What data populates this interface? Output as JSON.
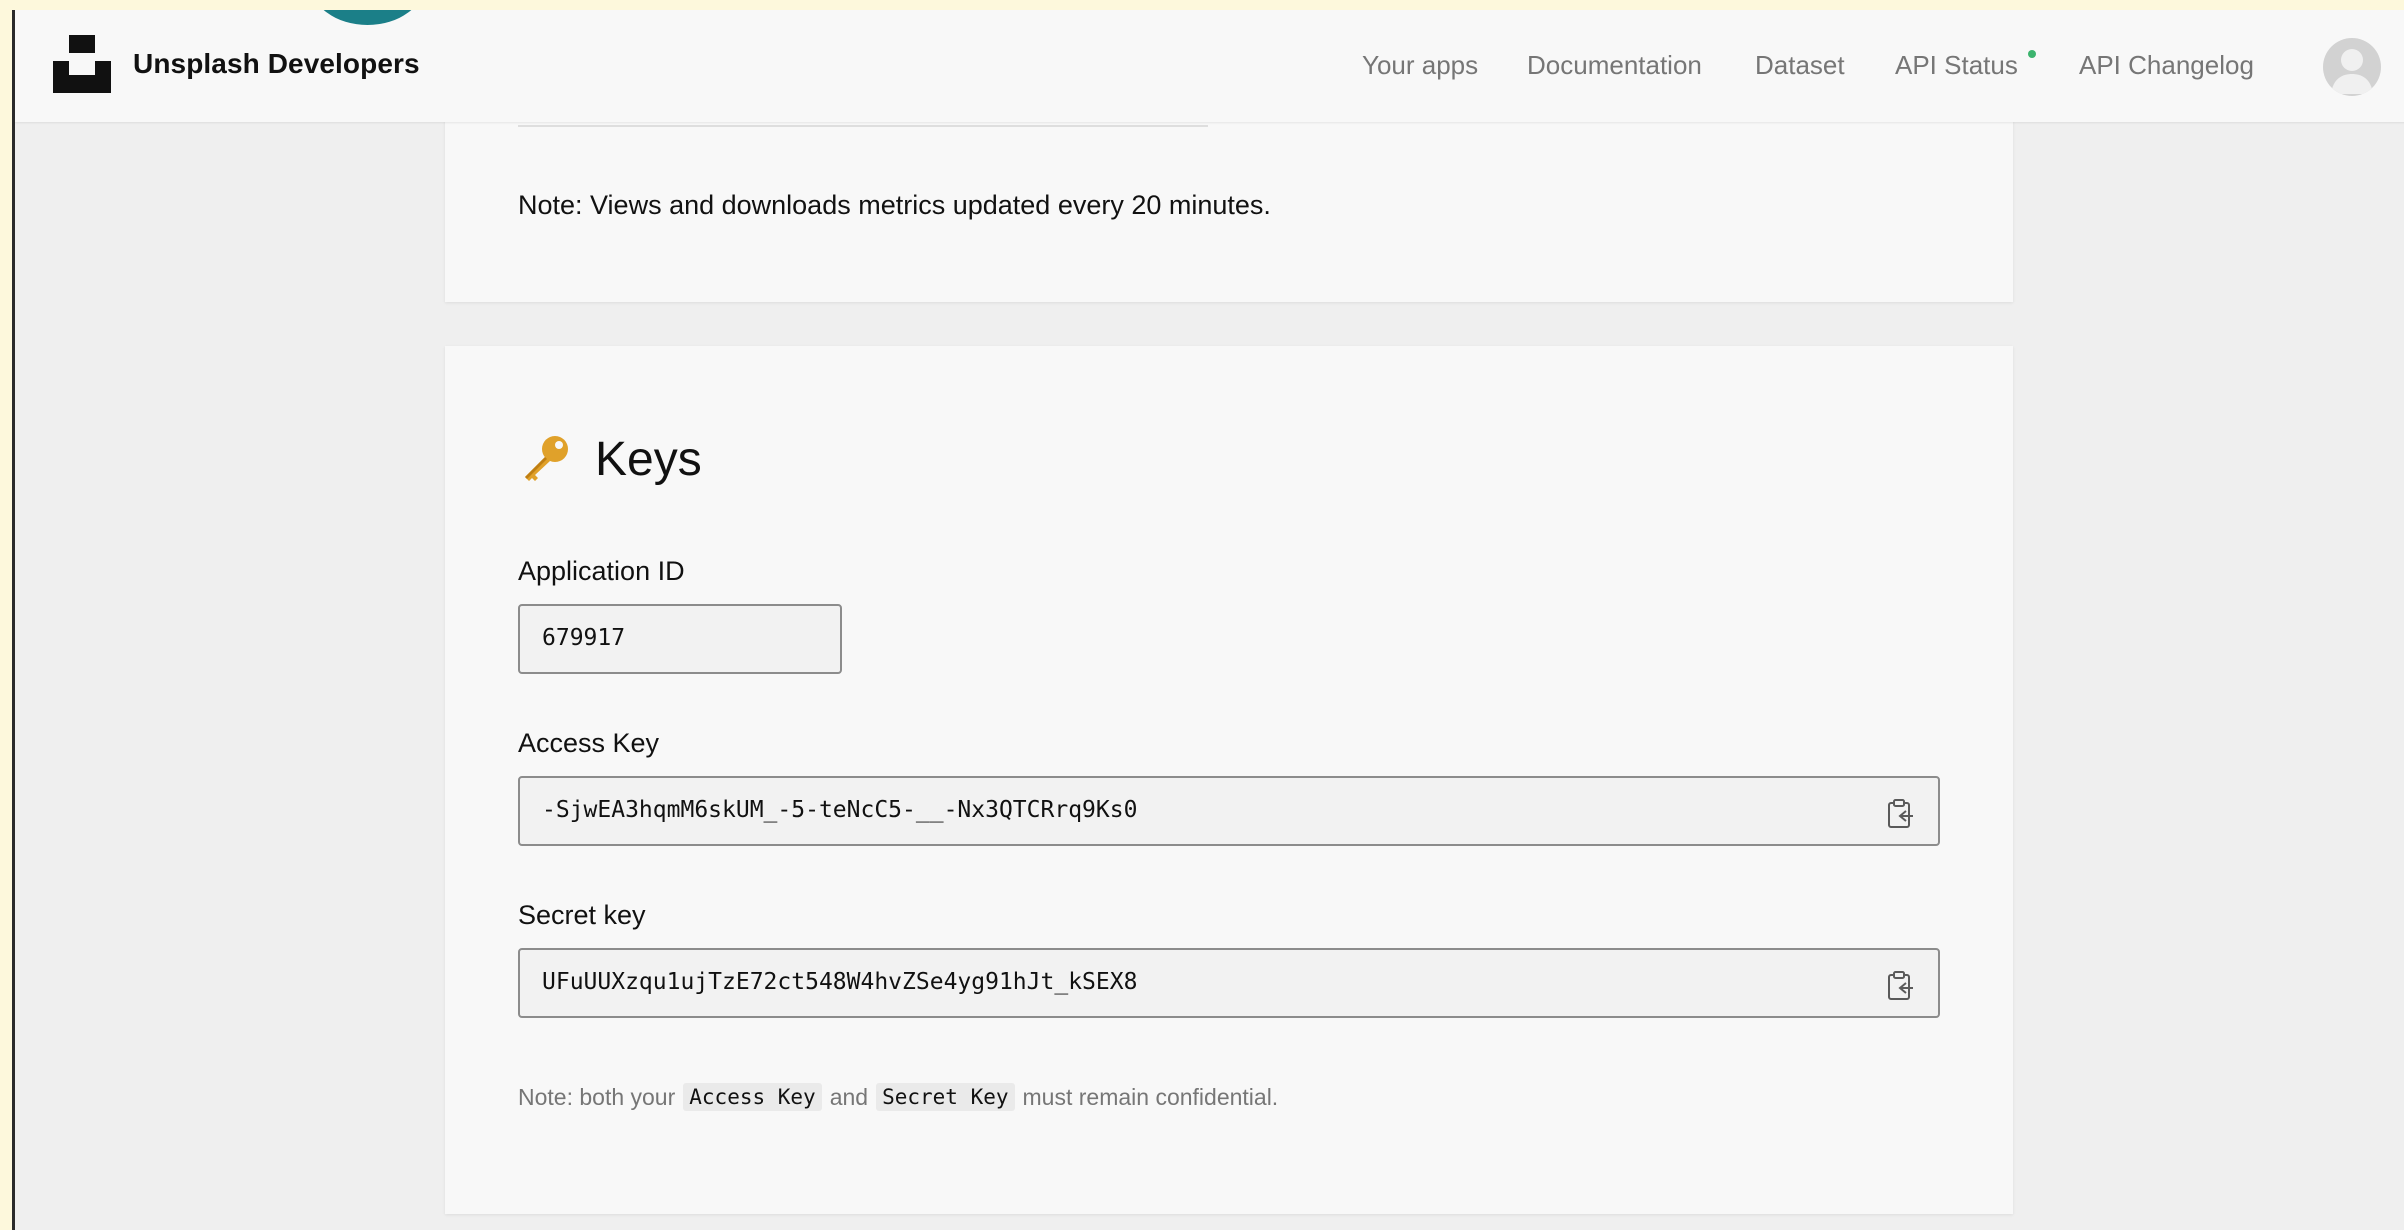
{
  "brand": {
    "name": "Unsplash Developers"
  },
  "nav": {
    "items": [
      {
        "label": "Your apps"
      },
      {
        "label": "Documentation"
      },
      {
        "label": "Dataset"
      },
      {
        "label": "API Status",
        "status_color": "#3cb46e"
      },
      {
        "label": "API Changelog"
      }
    ]
  },
  "top_card": {
    "note": "Note: Views and downloads metrics updated every 20 minutes."
  },
  "keys": {
    "title": "Keys",
    "icon": "key-icon",
    "application_id": {
      "label": "Application ID",
      "value": "679917"
    },
    "access_key": {
      "label": "Access Key",
      "value": "-SjwEA3hqmM6skUM_-5-teNcC5-__-Nx3QTCRrq9Ks0",
      "icon": "clipboard-icon"
    },
    "secret_key": {
      "label": "Secret key",
      "value": "UFuUUXzqu1ujTzE72ct548W4hvZSe4yg91hJt_kSEX8",
      "icon": "clipboard-icon"
    },
    "note": {
      "prefix": "Note: both your",
      "code1": "Access Key",
      "middle": "and",
      "code2": "Secret Key",
      "suffix": "must remain confidential."
    }
  },
  "colors": {
    "page_background": "#efefef",
    "header_background": "#f8f8f8",
    "outer_background": "#fdf8dc",
    "accent_teal": "#1b7f88"
  }
}
